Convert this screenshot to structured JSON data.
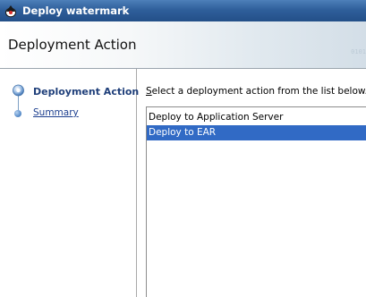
{
  "window": {
    "title": "Deploy watermark",
    "icon": "duke-icon"
  },
  "header": {
    "title": "Deployment Action",
    "decoration": "0101"
  },
  "nav": {
    "steps": [
      {
        "label": "Deployment Action",
        "state": "active"
      },
      {
        "label": "Summary",
        "state": "link"
      }
    ]
  },
  "content": {
    "instruction_mnemonic": "S",
    "instruction_rest": "elect a deployment action from the list below.",
    "actions": [
      {
        "label": "Deploy to Application Server",
        "selected": false
      },
      {
        "label": "Deploy to EAR",
        "selected": true
      }
    ]
  },
  "colors": {
    "titlebar": "#2f5f9b",
    "selection": "#316ac5",
    "nav_active": "#1f3f7a"
  }
}
